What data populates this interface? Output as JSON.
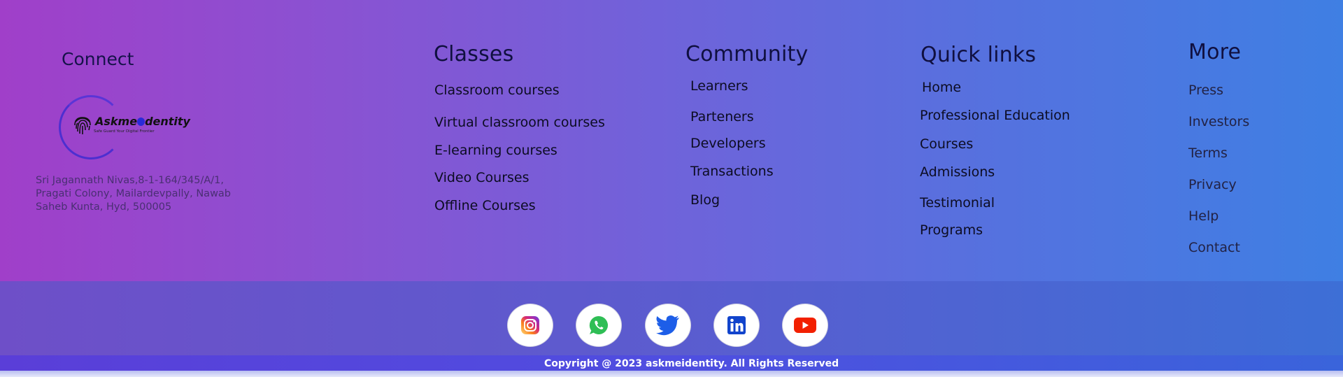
{
  "connect": {
    "heading": "Connect",
    "logo_name_part1": "Askme",
    "logo_name_part2": "dentity",
    "logo_tagline": "Safe Guard Your Digital Frontier",
    "address_line1": "Sri Jagannath Nivas,8-1-164/345/A/1,",
    "address_line2": "Pragati Colony, Mailardevpally, Nawab",
    "address_line3": "Saheb Kunta, Hyd, 500005"
  },
  "classes": {
    "heading": "Classes",
    "items": [
      "Classroom courses",
      "Virtual classroom courses",
      "E-learning courses",
      "Video Courses",
      "Offline Courses"
    ]
  },
  "community": {
    "heading": "Community",
    "items": [
      "Learners",
      "Parteners",
      "Developers",
      "Transactions",
      "Blog"
    ]
  },
  "quick_links": {
    "heading": "Quick links",
    "items": [
      "Home",
      "Professional Education",
      "Courses",
      "Admissions",
      "Testimonial",
      "Programs"
    ]
  },
  "more": {
    "heading": "More",
    "items": [
      "Press",
      "Investors",
      "Terms",
      "Privacy",
      "Help",
      "Contact"
    ]
  },
  "social": {
    "icons": [
      "instagram-icon",
      "whatsapp-icon",
      "twitter-icon",
      "linkedin-icon",
      "youtube-icon"
    ]
  },
  "copyright": "Copyright @ 2023 askmeidentity. All Rights Reserved",
  "colors": {
    "gradient_left": "#a03fc9",
    "gradient_right": "#3f7fe3",
    "heading_text": "#101040"
  }
}
